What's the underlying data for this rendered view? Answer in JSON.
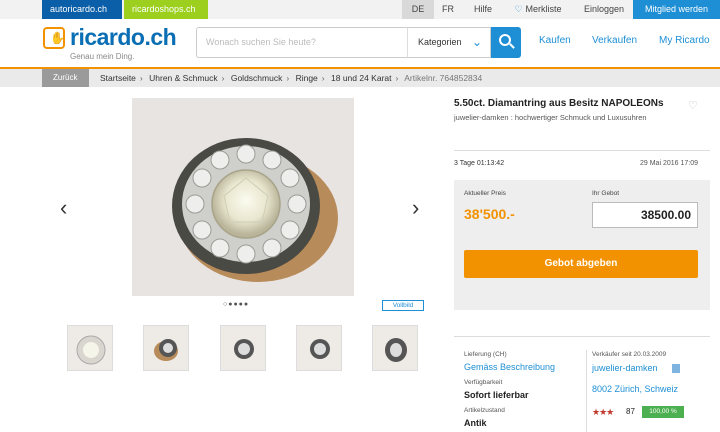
{
  "topbar": {
    "autoricardo": "autoricardo.ch",
    "ricardoshops": "ricardoshops.ch",
    "lang_de": "DE",
    "lang_fr": "FR",
    "help": "Hilfe",
    "watchlist": "Merkliste",
    "login": "Einloggen",
    "register": "Mitglied werden"
  },
  "header": {
    "logo": "ricardo.ch",
    "tagline": "Genau mein Ding.",
    "search_placeholder": "Wonach suchen Sie heute?",
    "category_label": "Kategorien",
    "nav": [
      "Kaufen",
      "Verkaufen",
      "My Ricardo"
    ]
  },
  "breadcrumb": {
    "back": "Zurück",
    "items": [
      "Startseite",
      "Uhren & Schmuck",
      "Goldschmuck",
      "Ringe",
      "18 und 24 Karat"
    ],
    "article_number": "Artikelnr. 764852834"
  },
  "gallery": {
    "fullscreen": "Vollbild",
    "image_count": 5,
    "active_index": 1
  },
  "listing": {
    "title": "5.50ct. Diamantring aus Besitz NAPOLEONs",
    "seller_description": "juwelier-damken : hochwertiger Schmuck und Luxusuhren",
    "time_left": "3 Tage 01:13:42",
    "end_date": "29 Mai 2016 17:09",
    "current_price_label": "Aktueller Preis",
    "current_price": "38'500.-",
    "bid_label": "Ihr Gebot",
    "bid_value": "38500.00",
    "bid_button": "Gebot abgeben"
  },
  "details": {
    "delivery_label": "Lieferung (CH)",
    "delivery_value": "Gemäss Beschreibung",
    "availability_label": "Verfügbarkeit",
    "availability_value": "Sofort lieferbar",
    "condition_label": "Artikelzustand",
    "condition_value": "Antik",
    "seller_since": "Verkäufer seit 20.03.2009",
    "seller_name": "juwelier-damken",
    "seller_location": "8002 Zürich, Schweiz",
    "stars": "★★★",
    "rating_count": "87",
    "positive": "100,00 %"
  },
  "colors": {
    "brand_blue": "#1e8fd5",
    "orange": "#f39200"
  }
}
